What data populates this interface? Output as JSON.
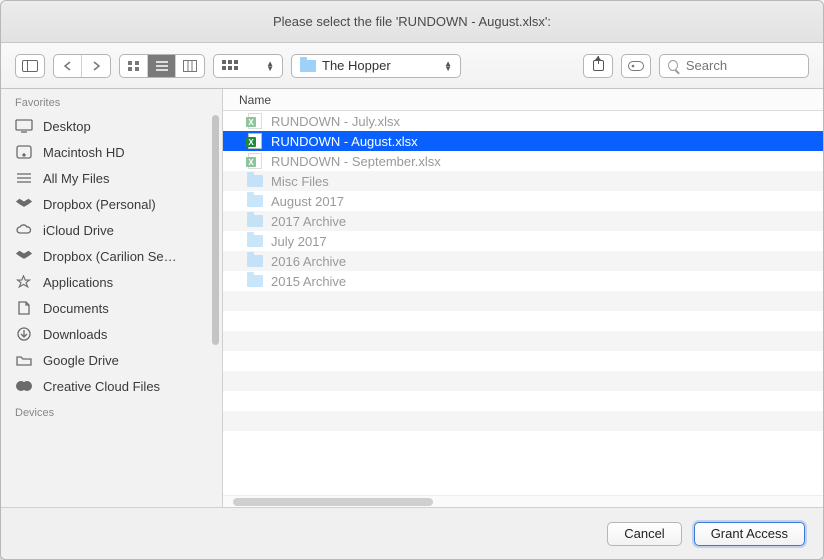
{
  "title": "Please select the file 'RUNDOWN - August.xlsx':",
  "toolbar": {
    "location": "The Hopper",
    "search_placeholder": "Search"
  },
  "sidebar": {
    "sections": [
      {
        "label": "Favorites",
        "items": [
          {
            "label": "Desktop",
            "icon": "desktop"
          },
          {
            "label": "Macintosh HD",
            "icon": "disk"
          },
          {
            "label": "All My Files",
            "icon": "allfiles"
          },
          {
            "label": "Dropbox (Personal)",
            "icon": "dropbox"
          },
          {
            "label": "iCloud Drive",
            "icon": "icloud"
          },
          {
            "label": "Dropbox (Carilion Se…",
            "icon": "dropbox"
          },
          {
            "label": "Applications",
            "icon": "applications"
          },
          {
            "label": "Documents",
            "icon": "documents"
          },
          {
            "label": "Downloads",
            "icon": "downloads"
          },
          {
            "label": "Google Drive",
            "icon": "folder"
          },
          {
            "label": "Creative Cloud Files",
            "icon": "cc"
          }
        ]
      },
      {
        "label": "Devices",
        "items": []
      }
    ]
  },
  "filepane": {
    "column_header": "Name",
    "rows": [
      {
        "name": "RUNDOWN - July.xlsx",
        "type": "xlsx",
        "selected": false,
        "dimmed": true
      },
      {
        "name": "RUNDOWN - August.xlsx",
        "type": "xlsx",
        "selected": true,
        "dimmed": false
      },
      {
        "name": "RUNDOWN - September.xlsx",
        "type": "xlsx",
        "selected": false,
        "dimmed": true
      },
      {
        "name": "Misc Files",
        "type": "folder",
        "selected": false,
        "dimmed": true
      },
      {
        "name": "August 2017",
        "type": "folder",
        "selected": false,
        "dimmed": true
      },
      {
        "name": "2017 Archive",
        "type": "folder",
        "selected": false,
        "dimmed": true
      },
      {
        "name": "July 2017",
        "type": "folder",
        "selected": false,
        "dimmed": true
      },
      {
        "name": "2016 Archive",
        "type": "folder",
        "selected": false,
        "dimmed": true
      },
      {
        "name": "2015 Archive",
        "type": "folder",
        "selected": false,
        "dimmed": true
      }
    ]
  },
  "footer": {
    "cancel": "Cancel",
    "confirm": "Grant Access"
  }
}
